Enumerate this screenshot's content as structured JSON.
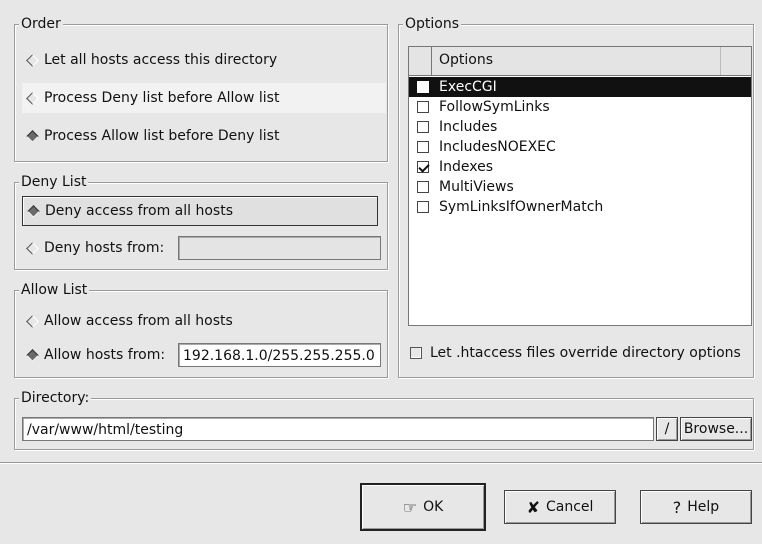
{
  "order": {
    "title": "Order",
    "options": [
      {
        "label": "Let all hosts access this directory",
        "state": "off"
      },
      {
        "label": "Process Deny list before Allow list",
        "state": "off"
      },
      {
        "label": "Process Allow list before Deny list",
        "state": "on"
      }
    ]
  },
  "deny_list": {
    "title": "Deny List",
    "all_label": "Deny access from all hosts",
    "hosts_label": "Deny hosts from:",
    "hosts_value": ""
  },
  "allow_list": {
    "title": "Allow List",
    "all_label": "Allow access from all hosts",
    "hosts_label": "Allow hosts from:",
    "hosts_value": "192.168.1.0/255.255.255.0"
  },
  "options": {
    "title": "Options",
    "column_header": "Options",
    "items": [
      {
        "label": "ExecCGI",
        "checked": false,
        "selected": true
      },
      {
        "label": "FollowSymLinks",
        "checked": false,
        "selected": false
      },
      {
        "label": "Includes",
        "checked": false,
        "selected": false
      },
      {
        "label": "IncludesNOEXEC",
        "checked": false,
        "selected": false
      },
      {
        "label": "Indexes",
        "checked": true,
        "selected": false
      },
      {
        "label": "MultiViews",
        "checked": false,
        "selected": false
      },
      {
        "label": "SymLinksIfOwnerMatch",
        "checked": false,
        "selected": false
      }
    ],
    "htaccess_label": "Let .htaccess files override directory options"
  },
  "directory": {
    "title": "Directory:",
    "value": "/var/www/html/testing",
    "slash_label": "/",
    "browse_label": "Browse..."
  },
  "buttons": {
    "ok": "OK",
    "cancel": "Cancel",
    "help": "Help"
  }
}
